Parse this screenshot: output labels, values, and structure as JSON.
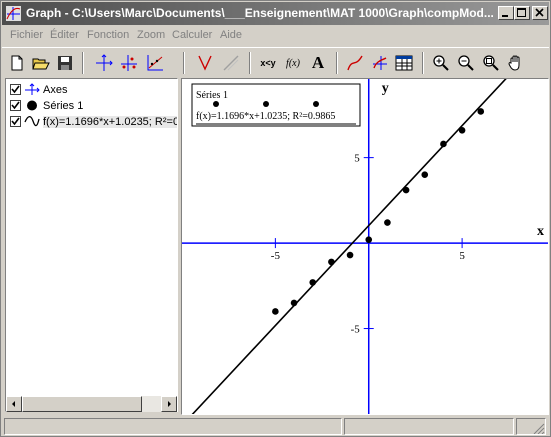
{
  "window": {
    "title": "Graph - C:\\Users\\Marc\\Documents\\___Enseignement\\MAT 1000\\Graph\\compMod..."
  },
  "menu": {
    "items": [
      "Fichier",
      "Éditer",
      "Fonction",
      "Zoom",
      "Calculer",
      "Aide"
    ]
  },
  "toolbar": {
    "tools": [
      "new-file-icon",
      "open-folder-icon",
      "save-disk-icon",
      "axes-icon",
      "insert-point-series-icon",
      "trendline-icon",
      "tangent-icon",
      "shading-icon",
      "xy-evaluate-icon",
      "fx-function-icon",
      "text-label-icon",
      "insert-function-icon",
      "insert-series-icon",
      "table-icon",
      "zoom-in-icon",
      "zoom-out-icon",
      "zoom-fit-icon",
      "pan-hand-icon"
    ],
    "evaluate_label": "x<y",
    "function_label": "f(x)",
    "text_label": "A"
  },
  "tree": {
    "items": [
      {
        "label": "Axes",
        "checked": true,
        "icon": "axes-icon"
      },
      {
        "label": "Séries 1",
        "checked": true,
        "icon": "point-series-icon"
      },
      {
        "label": "f(x)=1.1696*x+1.0235; R²=0.9865",
        "checked": true,
        "icon": "function-curve-icon"
      }
    ]
  },
  "plot": {
    "legend": {
      "series_label": "Séries 1",
      "function_label": "f(x)=1.1696*x+1.0235; R²=0.9865"
    },
    "x_axis_label": "x",
    "y_axis_label": "y",
    "colors": {
      "axes": "#0000ff",
      "series": "#000000",
      "trendline": "#000000",
      "background": "#ffffff"
    }
  },
  "chart_data": {
    "type": "scatter",
    "title": "",
    "xlabel": "x",
    "ylabel": "y",
    "xlim": [
      -10,
      9.6
    ],
    "ylim": [
      -10,
      9.6
    ],
    "x_ticks": [
      -5,
      5
    ],
    "y_ticks": [
      -5,
      5
    ],
    "x_tick_labels": [
      "-5",
      "5"
    ],
    "y_tick_labels": [
      "-5",
      "5"
    ],
    "grid": false,
    "legend_position": "top-left",
    "series": [
      {
        "name": "Séries 1",
        "points": [
          [
            -5,
            -4
          ],
          [
            -4,
            -3.5
          ],
          [
            -3,
            -2.3
          ],
          [
            -2,
            -1.1
          ],
          [
            -1,
            -0.7
          ],
          [
            0,
            0.2
          ],
          [
            1,
            1.2
          ],
          [
            2,
            3.1
          ],
          [
            3,
            4
          ],
          [
            4,
            5.8
          ],
          [
            5,
            6.6
          ],
          [
            6,
            7.7
          ]
        ]
      }
    ],
    "trendline": {
      "slope": 1.1696,
      "intercept": 1.0235,
      "r2": 0.9865
    }
  }
}
